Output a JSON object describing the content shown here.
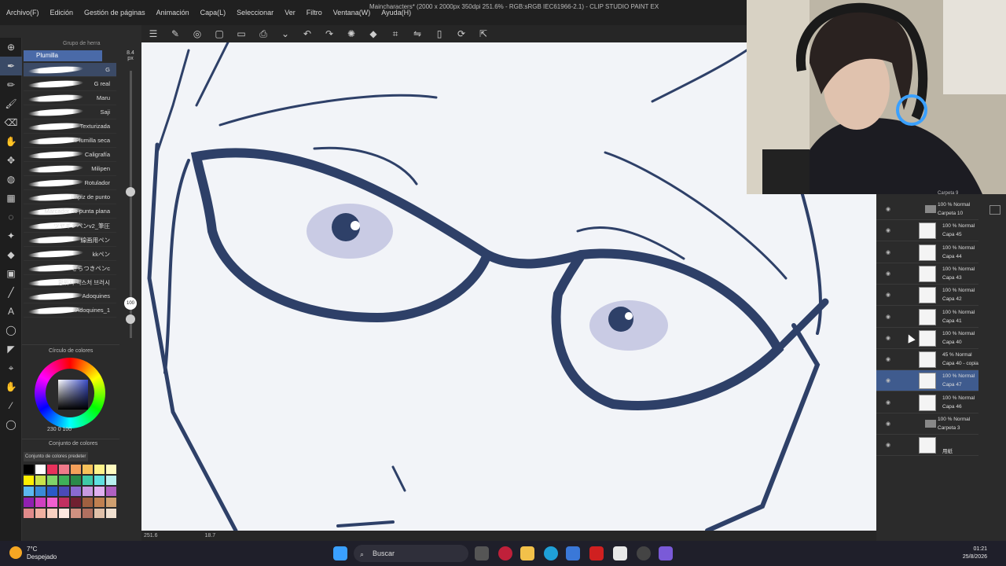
{
  "menu": {
    "items": [
      "Archivo(F)",
      "Edición",
      "Gestión de páginas",
      "Animación",
      "Capa(L)",
      "Seleccionar",
      "Ver",
      "Filtro",
      "Ventana(W)",
      "Ayuda(H)"
    ],
    "document_title": "Maincharacters* (2000 x 2000px 350dpi 251.6% - RGB:sRGB IEC61966-2.1) - CLIP STUDIO PAINT EX"
  },
  "subtool": {
    "header": "Grupo de herra",
    "group": "Plumilla",
    "brushes": [
      "G",
      "G real",
      "Maru",
      "Saji",
      "Texturizada",
      "Plumilla seca",
      "Caligrafía",
      "Milipen",
      "Rotulador",
      "Lápiz de punto",
      "Marcador de punta plana",
      "ツヤギンペンv2_筆圧",
      "線画用ペン",
      "kkペン",
      "ざらつきペンc",
      "황위지 픽스처 브러시",
      "Adoquines",
      "Adoquines_1"
    ]
  },
  "brush_size": {
    "value": "8.4",
    "unit": "px"
  },
  "opacity_badge": "100\n%",
  "colorwheel": {
    "title": "Círculo de colores",
    "readout": "230  0  100"
  },
  "colorset": {
    "title": "Conjunto de colores",
    "select": "Conjunto de colores predeter",
    "swatches": [
      "#000000",
      "#ffffff",
      "#e8315b",
      "#f07a8a",
      "#f4a05a",
      "#f7c15a",
      "#fff38a",
      "#fffbc0",
      "#ffee00",
      "#c9e24a",
      "#7fd36a",
      "#3fb05a",
      "#2a8a4a",
      "#3fc9a6",
      "#5fe0e0",
      "#b8f0f0",
      "#5cb8f0",
      "#3a8ad8",
      "#2a5ac8",
      "#4a4ab8",
      "#8a6ad0",
      "#c89ae0",
      "#e0b0f0",
      "#b060c0",
      "#9020b0",
      "#d040c0",
      "#f060d0",
      "#c03060",
      "#702030",
      "#a06040",
      "#c08050",
      "#d0a070",
      "#e08a8a",
      "#f0b0a0",
      "#f8d0c0",
      "#fde8e0",
      "#d09080",
      "#b07060",
      "#e0c0a8",
      "#f0e0d0"
    ]
  },
  "canvas_status": {
    "zoom": "251.6",
    "angle": "18.7"
  },
  "layers": [
    {
      "blend": "100 % Normal",
      "name": "Carpeta 10",
      "folder": true
    },
    {
      "blend": "100 % Normal",
      "name": "Capa 45"
    },
    {
      "blend": "100 % Normal",
      "name": "Capa 44"
    },
    {
      "blend": "100 % Normal",
      "name": "Capa 43"
    },
    {
      "blend": "100 % Normal",
      "name": "Capa 42"
    },
    {
      "blend": "100 % Normal",
      "name": "Capa 41"
    },
    {
      "blend": "100 % Normal",
      "name": "Capa 40"
    },
    {
      "blend": "45 % Normal",
      "name": "Capa 40 - copia"
    },
    {
      "blend": "100 % Normal",
      "name": "Capa 47",
      "selected": true
    },
    {
      "blend": "100 % Normal",
      "name": "Capa 46"
    },
    {
      "blend": "100 % Normal",
      "name": "Carpeta 3",
      "folder": true
    },
    {
      "blend": "",
      "name": "用紙"
    }
  ],
  "layer_top_partial": "Carpeta 9",
  "taskbar": {
    "temperature": "7°C",
    "weather": "Despejado",
    "search_placeholder": "Buscar",
    "time": "01:21",
    "date": "25/8/2026"
  },
  "colors": {
    "accent": "#4a6aa8",
    "line_art": "#2e4068",
    "canvas_bg": "#f2f4f8"
  }
}
